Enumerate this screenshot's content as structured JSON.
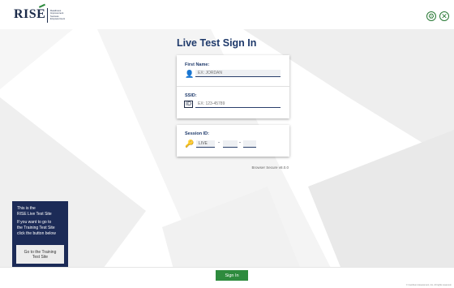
{
  "header": {
    "logo_text": "RISE",
    "logo_subtitle": "Readiness Improvement Success Empowerment",
    "settings_icon": "gear-icon",
    "close_icon": "close-icon"
  },
  "title": "Live Test Sign In",
  "form": {
    "first_name_label": "First Name:",
    "first_name_placeholder": "EX: JORDAN",
    "ssid_label": "SSID:",
    "ssid_placeholder": "EX: 123-45789",
    "session_label": "Session ID:",
    "session_prefix": "LIVE",
    "session_part2": "",
    "session_part3": "",
    "separator": "-"
  },
  "version": "Browser Secure v8.0.0",
  "side_panel": {
    "line1": "This is the",
    "line2": "RISE Live Test Site",
    "line3": "If you want to go to",
    "line4": "the Training Test Site",
    "line5": "click the button below",
    "button_line1": "Go to the Training",
    "button_line2": "Test Site",
    "footer": "RISE Live Test Site"
  },
  "signin_label": "Sign In",
  "copyright": "© Cambium Assessment, Inc. All rights reserved.",
  "colors": {
    "accent": "#2e8b3e",
    "navy": "#1c2b57",
    "title": "#1f3a6b"
  }
}
